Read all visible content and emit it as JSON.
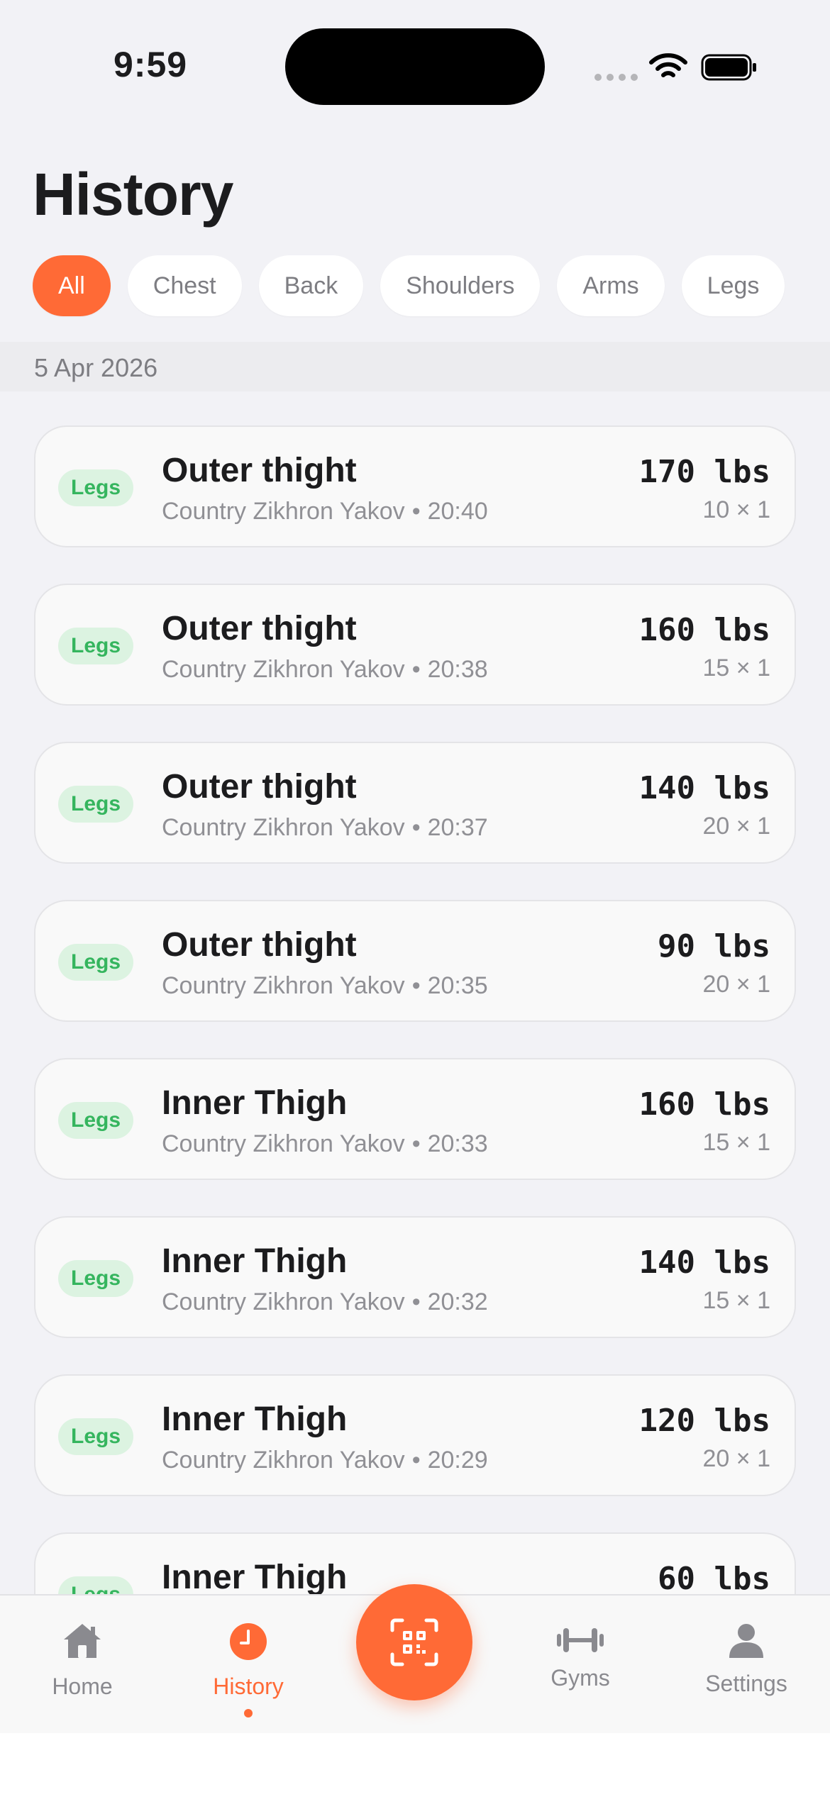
{
  "status_bar": {
    "time": "9:59"
  },
  "header": {
    "title": "History"
  },
  "filters": [
    {
      "label": "All",
      "active": true
    },
    {
      "label": "Chest",
      "active": false
    },
    {
      "label": "Back",
      "active": false
    },
    {
      "label": "Shoulders",
      "active": false
    },
    {
      "label": "Arms",
      "active": false
    },
    {
      "label": "Legs",
      "active": false
    }
  ],
  "section": {
    "date": "5 Apr 2026"
  },
  "entries": [
    {
      "badge": "Legs",
      "name": "Outer thight",
      "location": "Country Zikhron Yakov",
      "separator": "•",
      "time": "20:40",
      "weight": "170 lbs",
      "reps": "10 × 1"
    },
    {
      "badge": "Legs",
      "name": "Outer thight",
      "location": "Country Zikhron Yakov",
      "separator": "•",
      "time": "20:38",
      "weight": "160 lbs",
      "reps": "15 × 1"
    },
    {
      "badge": "Legs",
      "name": "Outer thight",
      "location": "Country Zikhron Yakov",
      "separator": "•",
      "time": "20:37",
      "weight": "140 lbs",
      "reps": "20 × 1"
    },
    {
      "badge": "Legs",
      "name": "Outer thight",
      "location": "Country Zikhron Yakov",
      "separator": "•",
      "time": "20:35",
      "weight": "90 lbs",
      "reps": "20 × 1"
    },
    {
      "badge": "Legs",
      "name": "Inner Thigh",
      "location": "Country Zikhron Yakov",
      "separator": "•",
      "time": "20:33",
      "weight": "160 lbs",
      "reps": "15 × 1"
    },
    {
      "badge": "Legs",
      "name": "Inner Thigh",
      "location": "Country Zikhron Yakov",
      "separator": "•",
      "time": "20:32",
      "weight": "140 lbs",
      "reps": "15 × 1"
    },
    {
      "badge": "Legs",
      "name": "Inner Thigh",
      "location": "Country Zikhron Yakov",
      "separator": "•",
      "time": "20:29",
      "weight": "120 lbs",
      "reps": "20 × 1"
    },
    {
      "badge": "Legs",
      "name": "Inner Thigh",
      "location": "",
      "separator": "",
      "time": "",
      "weight": "60 lbs",
      "reps": ""
    }
  ],
  "tabbar": {
    "home": {
      "label": "Home",
      "icon": "house-icon"
    },
    "history": {
      "label": "History",
      "icon": "clock-icon",
      "active": true
    },
    "scan": {
      "icon": "qr-scan-icon"
    },
    "gyms": {
      "label": "Gyms",
      "icon": "dumbbell-icon"
    },
    "settings": {
      "label": "Settings",
      "icon": "person-icon"
    }
  },
  "colors": {
    "accent": "#ff6a36",
    "badge_bg": "#dcf3e1",
    "badge_text": "#35b55e"
  }
}
